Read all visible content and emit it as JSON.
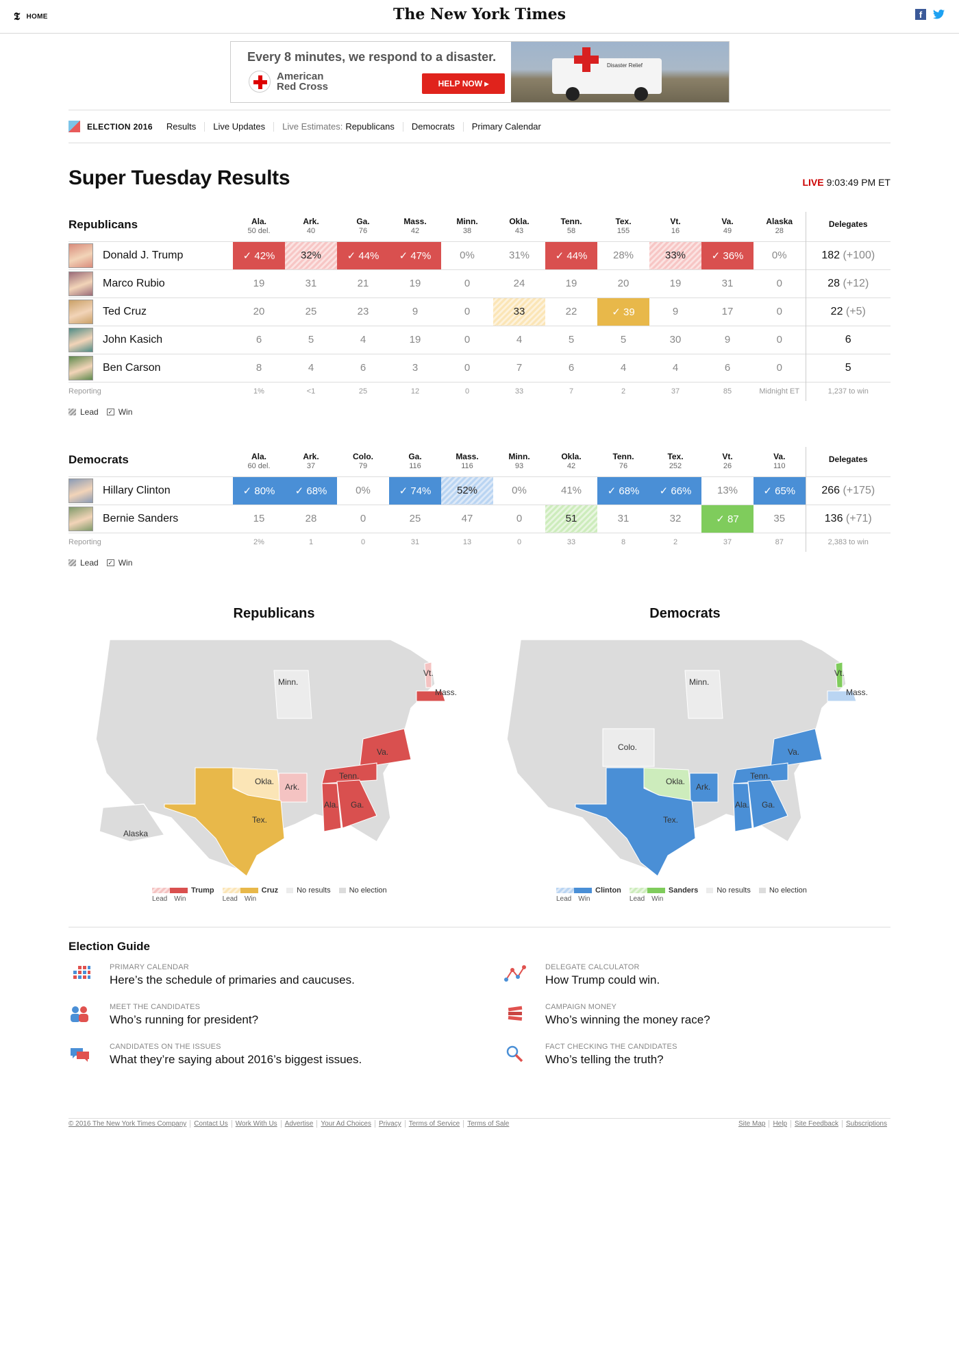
{
  "header": {
    "home_glyph": "𝕿",
    "home_label": "HOME",
    "logo": "The New York Times",
    "facebook_glyph": "f",
    "twitter_glyph": "🐦"
  },
  "ad": {
    "headline": "Every 8 minutes, we respond to a disaster.",
    "org_line1": "American",
    "org_line2": "Red Cross",
    "button": "HELP NOW ▸",
    "truck_text": "Disaster Relief"
  },
  "nav": {
    "brand": "ELECTION 2016",
    "results": "Results",
    "live_updates": "Live Updates",
    "live_estimates": "Live Estimates:",
    "republicans": "Republicans",
    "democrats": "Democrats",
    "primary_calendar": "Primary Calendar"
  },
  "page": {
    "title": "Super Tuesday Results",
    "live_label": "LIVE",
    "live_time": "9:03:49 PM ET"
  },
  "republicans": {
    "party": "Republicans",
    "delegates_label": "Delegates",
    "states": [
      {
        "name": "Ala.",
        "del": "50 del."
      },
      {
        "name": "Ark.",
        "del": "40"
      },
      {
        "name": "Ga.",
        "del": "76"
      },
      {
        "name": "Mass.",
        "del": "42"
      },
      {
        "name": "Minn.",
        "del": "38"
      },
      {
        "name": "Okla.",
        "del": "43"
      },
      {
        "name": "Tenn.",
        "del": "58"
      },
      {
        "name": "Tex.",
        "del": "155"
      },
      {
        "name": "Vt.",
        "del": "16"
      },
      {
        "name": "Va.",
        "del": "49"
      },
      {
        "name": "Alaska",
        "del": "28"
      }
    ],
    "candidates": [
      {
        "name": "Donald J. Trump",
        "photo_color": "#d98c7c",
        "cells": [
          "✓ 42%",
          "32%",
          "✓ 44%",
          "✓ 47%",
          "0%",
          "31%",
          "✓ 44%",
          "28%",
          "33%",
          "✓ 36%",
          "0%"
        ],
        "styles": [
          "wr",
          "lr",
          "wr",
          "wr",
          "",
          "",
          "wr",
          "",
          "lr",
          "wr",
          ""
        ],
        "delegates": "182",
        "change": "(+100)"
      },
      {
        "name": "Marco Rubio",
        "photo_color": "#9a6a78",
        "cells": [
          "19",
          "31",
          "21",
          "19",
          "0",
          "24",
          "19",
          "20",
          "19",
          "31",
          "0"
        ],
        "styles": [
          "",
          "",
          "",
          "",
          "",
          "",
          "",
          "",
          "",
          "",
          ""
        ],
        "delegates": "28",
        "change": "(+12)"
      },
      {
        "name": "Ted Cruz",
        "photo_color": "#c9a067",
        "cells": [
          "20",
          "25",
          "23",
          "9",
          "0",
          "33",
          "22",
          "✓ 39",
          "9",
          "17",
          "0"
        ],
        "styles": [
          "",
          "",
          "",
          "",
          "",
          "ly",
          "",
          "wy",
          "",
          "",
          ""
        ],
        "delegates": "22",
        "change": "(+5)"
      },
      {
        "name": "John Kasich",
        "photo_color": "#4f8c86",
        "cells": [
          "6",
          "5",
          "4",
          "19",
          "0",
          "4",
          "5",
          "5",
          "30",
          "9",
          "0"
        ],
        "styles": [
          "",
          "",
          "",
          "",
          "",
          "",
          "",
          "",
          "",
          "",
          ""
        ],
        "delegates": "6",
        "change": ""
      },
      {
        "name": "Ben Carson",
        "photo_color": "#5e8a4d",
        "cells": [
          "8",
          "4",
          "6",
          "3",
          "0",
          "7",
          "6",
          "4",
          "4",
          "6",
          "0"
        ],
        "styles": [
          "",
          "",
          "",
          "",
          "",
          "",
          "",
          "",
          "",
          "",
          ""
        ],
        "delegates": "5",
        "change": ""
      }
    ],
    "reporting_label": "Reporting",
    "reporting": [
      "1%",
      "<1",
      "25",
      "12",
      "0",
      "33",
      "7",
      "2",
      "37",
      "85",
      "Midnight ET"
    ],
    "to_win": "1,237 to win"
  },
  "democrats": {
    "party": "Democrats",
    "delegates_label": "Delegates",
    "states": [
      {
        "name": "Ala.",
        "del": "60 del."
      },
      {
        "name": "Ark.",
        "del": "37"
      },
      {
        "name": "Colo.",
        "del": "79"
      },
      {
        "name": "Ga.",
        "del": "116"
      },
      {
        "name": "Mass.",
        "del": "116"
      },
      {
        "name": "Minn.",
        "del": "93"
      },
      {
        "name": "Okla.",
        "del": "42"
      },
      {
        "name": "Tenn.",
        "del": "76"
      },
      {
        "name": "Tex.",
        "del": "252"
      },
      {
        "name": "Vt.",
        "del": "26"
      },
      {
        "name": "Va.",
        "del": "110"
      }
    ],
    "candidates": [
      {
        "name": "Hillary Clinton",
        "photo_color": "#8a9bb5",
        "cells": [
          "✓ 80%",
          "✓ 68%",
          "0%",
          "✓ 74%",
          "52%",
          "0%",
          "41%",
          "✓ 68%",
          "✓ 66%",
          "13%",
          "✓ 65%"
        ],
        "styles": [
          "wb",
          "wb",
          "",
          "wb",
          "lb",
          "",
          "",
          "wb",
          "wb",
          "",
          "wb"
        ],
        "delegates": "266",
        "change": "(+175)"
      },
      {
        "name": "Bernie Sanders",
        "photo_color": "#7f9a6a",
        "cells": [
          "15",
          "28",
          "0",
          "25",
          "47",
          "0",
          "51",
          "31",
          "32",
          "✓ 87",
          "35"
        ],
        "styles": [
          "",
          "",
          "",
          "",
          "",
          "",
          "lg",
          "",
          "",
          "wg",
          ""
        ],
        "delegates": "136",
        "change": "(+71)"
      }
    ],
    "reporting_label": "Reporting",
    "reporting": [
      "2%",
      "1",
      "0",
      "31",
      "13",
      "0",
      "33",
      "8",
      "2",
      "37",
      "87"
    ],
    "to_win": "2,383 to win"
  },
  "legend": {
    "lead": "Lead",
    "win": "Win",
    "win_check": "✓"
  },
  "maps": {
    "rep": {
      "title": "Republicans",
      "labels": {
        "minn": "Minn.",
        "vt": "Vt.",
        "mass": "Mass.",
        "va": "Va.",
        "tenn": "Tenn.",
        "okla": "Okla.",
        "ark": "Ark.",
        "ala": "Ala.",
        "ga": "Ga.",
        "tex": "Tex.",
        "alaska": "Alaska"
      },
      "legend": {
        "c1": "Trump",
        "c2": "Cruz",
        "no_results": "No results",
        "no_election": "No election",
        "lead": "Lead",
        "win": "Win"
      }
    },
    "dem": {
      "title": "Democrats",
      "labels": {
        "minn": "Minn.",
        "vt": "Vt.",
        "mass": "Mass.",
        "colo": "Colo.",
        "va": "Va.",
        "tenn": "Tenn.",
        "okla": "Okla.",
        "ark": "Ark.",
        "ala": "Ala.",
        "ga": "Ga.",
        "tex": "Tex."
      },
      "legend": {
        "c1": "Clinton",
        "c2": "Sanders",
        "no_results": "No results",
        "no_election": "No election",
        "lead": "Lead",
        "win": "Win"
      }
    },
    "colors": {
      "trump_win": "#d9504f",
      "trump_lead": "#f4c3c2",
      "cruz_win": "#e8b84a",
      "cruz_lead": "#fbe5b6",
      "clinton_win": "#4a8fd6",
      "clinton_lead": "#bad5f2",
      "sanders_win": "#7fcc5c",
      "sanders_lead": "#cdecbc",
      "no_results": "#ececec",
      "no_election": "#dcdcdc"
    }
  },
  "guide": {
    "heading": "Election Guide",
    "items": [
      {
        "small": "PRIMARY CALENDAR",
        "big": "Here’s the schedule of primaries and caucuses."
      },
      {
        "small": "DELEGATE CALCULATOR",
        "big": "How Trump could win."
      },
      {
        "small": "MEET THE CANDIDATES",
        "big": "Who’s running for president?"
      },
      {
        "small": "CAMPAIGN MONEY",
        "big": "Who’s winning the money race?"
      },
      {
        "small": "CANDIDATES ON THE ISSUES",
        "big": "What they’re saying about 2016’s biggest issues."
      },
      {
        "small": "FACT CHECKING THE CANDIDATES",
        "big": "Who’s telling the truth?"
      }
    ]
  },
  "footer": {
    "left": [
      "© 2016 The New York Times Company",
      "Contact Us",
      "Work With Us",
      "Advertise",
      "Your Ad Choices",
      "Privacy",
      "Terms of Service",
      "Terms of Sale"
    ],
    "right": [
      "Site Map",
      "Help",
      "Site Feedback",
      "Subscriptions"
    ]
  }
}
